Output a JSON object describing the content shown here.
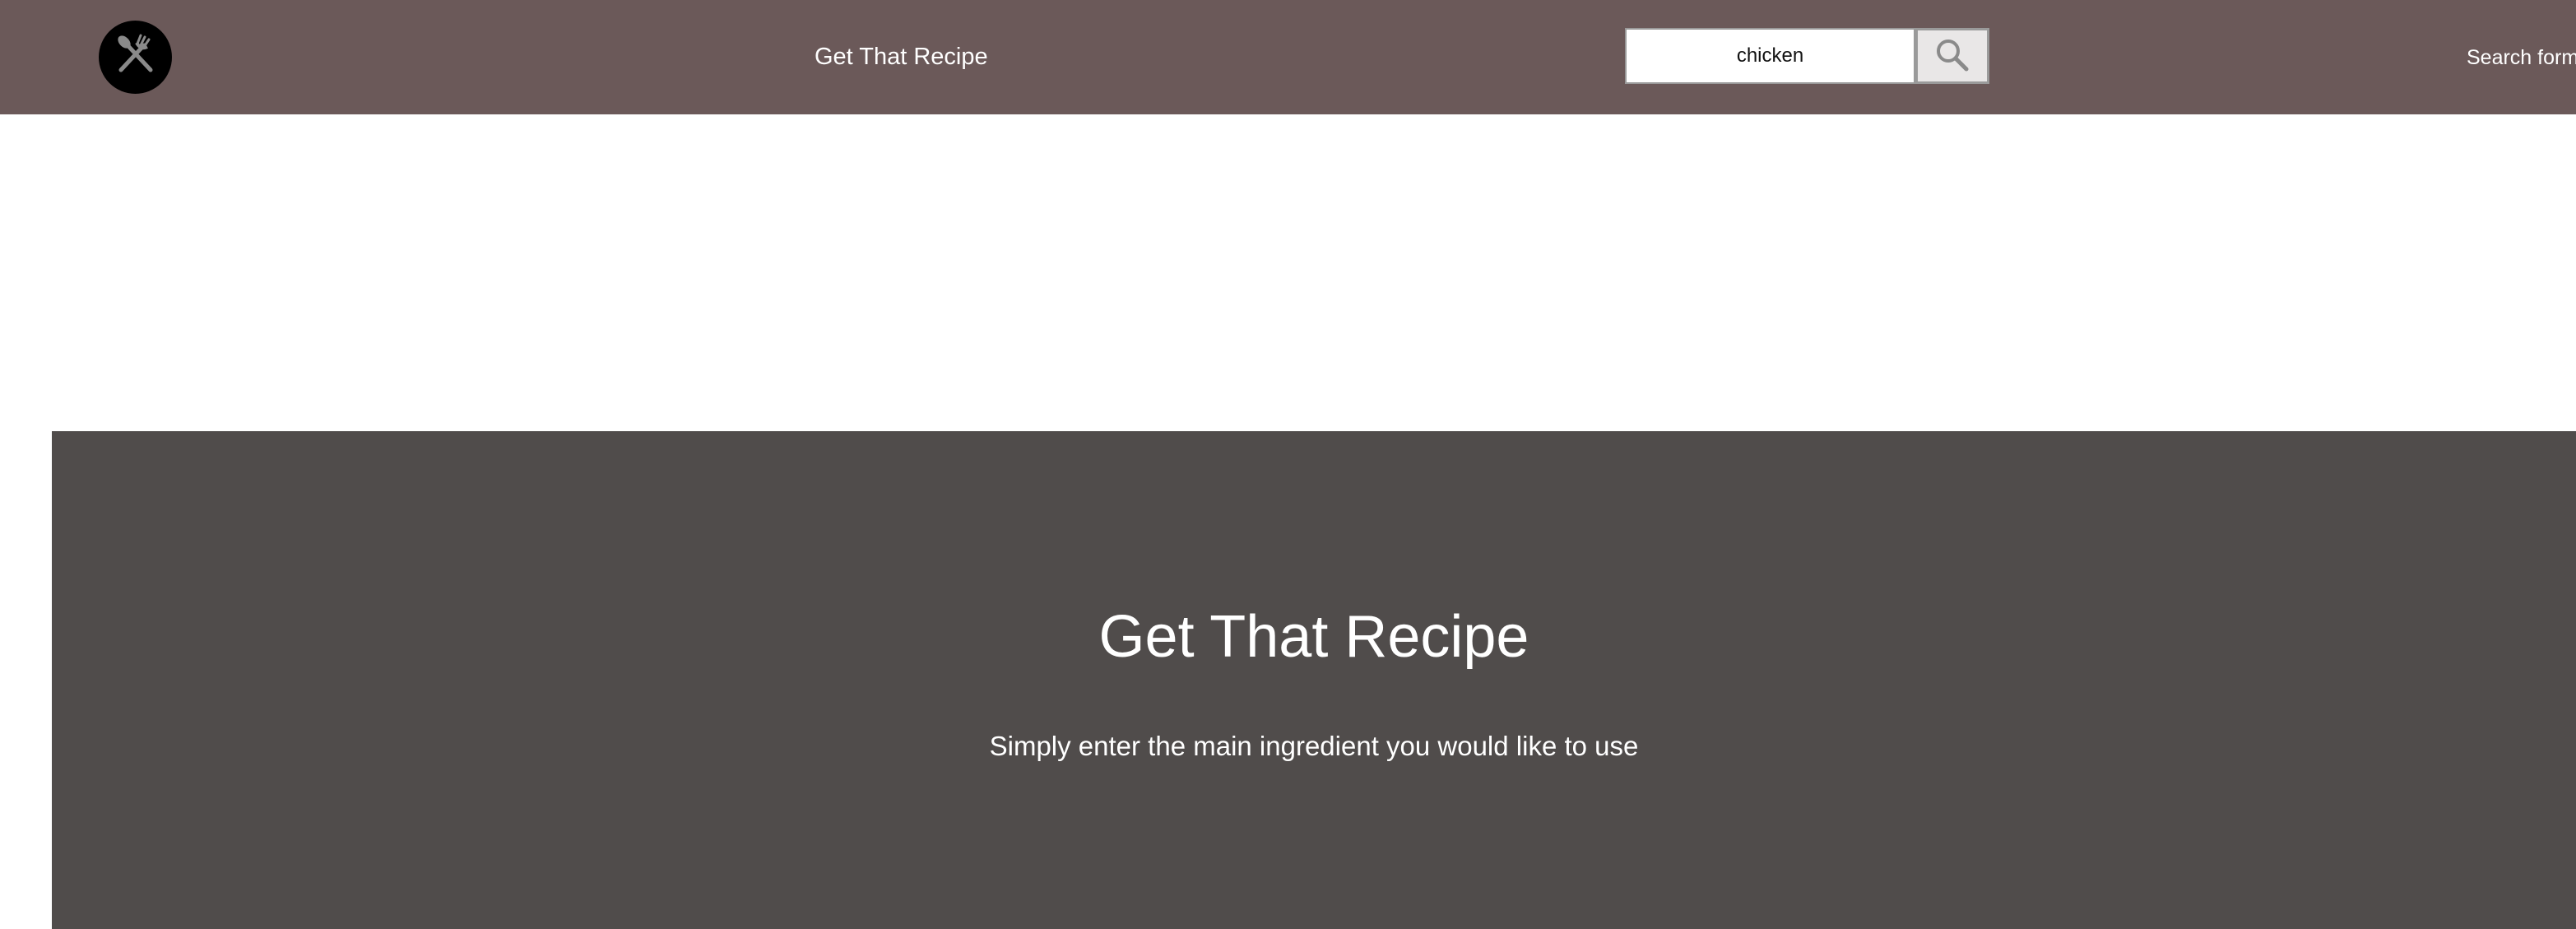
{
  "navbar": {
    "logo_icon": "fork-and-knife-icon",
    "brand": "Get That Recipe",
    "search": {
      "value": "chicken",
      "placeholder": "",
      "button_icon": "search-icon"
    },
    "link_label": "Search form"
  },
  "hero": {
    "title": "Get That Recipe",
    "subtitle": "Simply enter the main ingredient you would like to use"
  },
  "colors": {
    "navbar_bg": "#6b5959",
    "hero_bg": "#504c4b",
    "text_light": "#ffffff",
    "logo_bg": "#000000",
    "icon_gray": "#8a8a8a"
  }
}
